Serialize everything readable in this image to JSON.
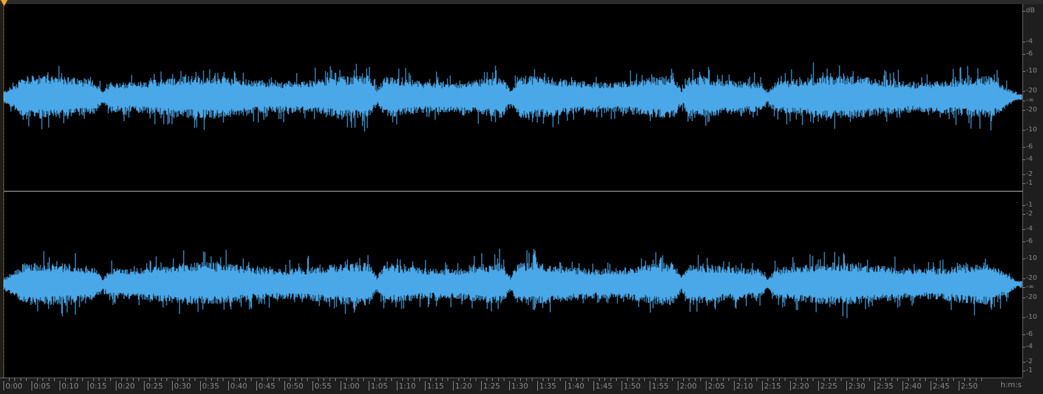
{
  "colors": {
    "waveform": "#4aa8e8",
    "background": "#000000",
    "ruler_text": "#8a8a8a",
    "playhead": "#f0a830"
  },
  "db_ruler": {
    "unit": "dB",
    "channel1": [
      "-4",
      "-6",
      "-10",
      "-20",
      "-∞",
      "-20",
      "-10",
      "-6",
      "-4",
      "-2",
      "-1"
    ],
    "channel2": [
      "-1",
      "-2",
      "-4",
      "-6",
      "-10",
      "-20",
      "-∞",
      "-20",
      "-10",
      "-6",
      "-4",
      "-2",
      "-1"
    ]
  },
  "time_ruler": {
    "labels": [
      "0:00",
      "0:05",
      "0:10",
      "0:15",
      "0:20",
      "0:25",
      "0:30",
      "0:35",
      "0:40",
      "0:45",
      "0:50",
      "0:55",
      "1:00",
      "1:05",
      "1:10",
      "1:15",
      "1:20",
      "1:25",
      "1:30",
      "1:35",
      "1:40",
      "1:45",
      "1:50",
      "1:55",
      "2:00",
      "2:05",
      "2:10",
      "2:15",
      "2:20",
      "2:25",
      "2:30",
      "2:35",
      "2:40",
      "2:45",
      "2:50"
    ],
    "unit": "h:m:s"
  }
}
